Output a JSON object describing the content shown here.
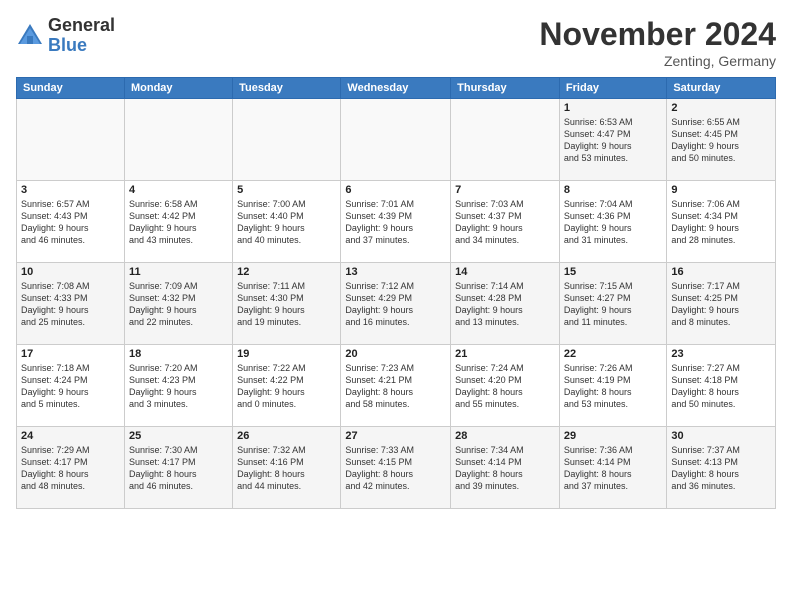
{
  "logo": {
    "general": "General",
    "blue": "Blue"
  },
  "header": {
    "title": "November 2024",
    "location": "Zenting, Germany"
  },
  "weekdays": [
    "Sunday",
    "Monday",
    "Tuesday",
    "Wednesday",
    "Thursday",
    "Friday",
    "Saturday"
  ],
  "weeks": [
    [
      {
        "day": "",
        "info": ""
      },
      {
        "day": "",
        "info": ""
      },
      {
        "day": "",
        "info": ""
      },
      {
        "day": "",
        "info": ""
      },
      {
        "day": "",
        "info": ""
      },
      {
        "day": "1",
        "info": "Sunrise: 6:53 AM\nSunset: 4:47 PM\nDaylight: 9 hours\nand 53 minutes."
      },
      {
        "day": "2",
        "info": "Sunrise: 6:55 AM\nSunset: 4:45 PM\nDaylight: 9 hours\nand 50 minutes."
      }
    ],
    [
      {
        "day": "3",
        "info": "Sunrise: 6:57 AM\nSunset: 4:43 PM\nDaylight: 9 hours\nand 46 minutes."
      },
      {
        "day": "4",
        "info": "Sunrise: 6:58 AM\nSunset: 4:42 PM\nDaylight: 9 hours\nand 43 minutes."
      },
      {
        "day": "5",
        "info": "Sunrise: 7:00 AM\nSunset: 4:40 PM\nDaylight: 9 hours\nand 40 minutes."
      },
      {
        "day": "6",
        "info": "Sunrise: 7:01 AM\nSunset: 4:39 PM\nDaylight: 9 hours\nand 37 minutes."
      },
      {
        "day": "7",
        "info": "Sunrise: 7:03 AM\nSunset: 4:37 PM\nDaylight: 9 hours\nand 34 minutes."
      },
      {
        "day": "8",
        "info": "Sunrise: 7:04 AM\nSunset: 4:36 PM\nDaylight: 9 hours\nand 31 minutes."
      },
      {
        "day": "9",
        "info": "Sunrise: 7:06 AM\nSunset: 4:34 PM\nDaylight: 9 hours\nand 28 minutes."
      }
    ],
    [
      {
        "day": "10",
        "info": "Sunrise: 7:08 AM\nSunset: 4:33 PM\nDaylight: 9 hours\nand 25 minutes."
      },
      {
        "day": "11",
        "info": "Sunrise: 7:09 AM\nSunset: 4:32 PM\nDaylight: 9 hours\nand 22 minutes."
      },
      {
        "day": "12",
        "info": "Sunrise: 7:11 AM\nSunset: 4:30 PM\nDaylight: 9 hours\nand 19 minutes."
      },
      {
        "day": "13",
        "info": "Sunrise: 7:12 AM\nSunset: 4:29 PM\nDaylight: 9 hours\nand 16 minutes."
      },
      {
        "day": "14",
        "info": "Sunrise: 7:14 AM\nSunset: 4:28 PM\nDaylight: 9 hours\nand 13 minutes."
      },
      {
        "day": "15",
        "info": "Sunrise: 7:15 AM\nSunset: 4:27 PM\nDaylight: 9 hours\nand 11 minutes."
      },
      {
        "day": "16",
        "info": "Sunrise: 7:17 AM\nSunset: 4:25 PM\nDaylight: 9 hours\nand 8 minutes."
      }
    ],
    [
      {
        "day": "17",
        "info": "Sunrise: 7:18 AM\nSunset: 4:24 PM\nDaylight: 9 hours\nand 5 minutes."
      },
      {
        "day": "18",
        "info": "Sunrise: 7:20 AM\nSunset: 4:23 PM\nDaylight: 9 hours\nand 3 minutes."
      },
      {
        "day": "19",
        "info": "Sunrise: 7:22 AM\nSunset: 4:22 PM\nDaylight: 9 hours\nand 0 minutes."
      },
      {
        "day": "20",
        "info": "Sunrise: 7:23 AM\nSunset: 4:21 PM\nDaylight: 8 hours\nand 58 minutes."
      },
      {
        "day": "21",
        "info": "Sunrise: 7:24 AM\nSunset: 4:20 PM\nDaylight: 8 hours\nand 55 minutes."
      },
      {
        "day": "22",
        "info": "Sunrise: 7:26 AM\nSunset: 4:19 PM\nDaylight: 8 hours\nand 53 minutes."
      },
      {
        "day": "23",
        "info": "Sunrise: 7:27 AM\nSunset: 4:18 PM\nDaylight: 8 hours\nand 50 minutes."
      }
    ],
    [
      {
        "day": "24",
        "info": "Sunrise: 7:29 AM\nSunset: 4:17 PM\nDaylight: 8 hours\nand 48 minutes."
      },
      {
        "day": "25",
        "info": "Sunrise: 7:30 AM\nSunset: 4:17 PM\nDaylight: 8 hours\nand 46 minutes."
      },
      {
        "day": "26",
        "info": "Sunrise: 7:32 AM\nSunset: 4:16 PM\nDaylight: 8 hours\nand 44 minutes."
      },
      {
        "day": "27",
        "info": "Sunrise: 7:33 AM\nSunset: 4:15 PM\nDaylight: 8 hours\nand 42 minutes."
      },
      {
        "day": "28",
        "info": "Sunrise: 7:34 AM\nSunset: 4:14 PM\nDaylight: 8 hours\nand 39 minutes."
      },
      {
        "day": "29",
        "info": "Sunrise: 7:36 AM\nSunset: 4:14 PM\nDaylight: 8 hours\nand 37 minutes."
      },
      {
        "day": "30",
        "info": "Sunrise: 7:37 AM\nSunset: 4:13 PM\nDaylight: 8 hours\nand 36 minutes."
      }
    ]
  ]
}
